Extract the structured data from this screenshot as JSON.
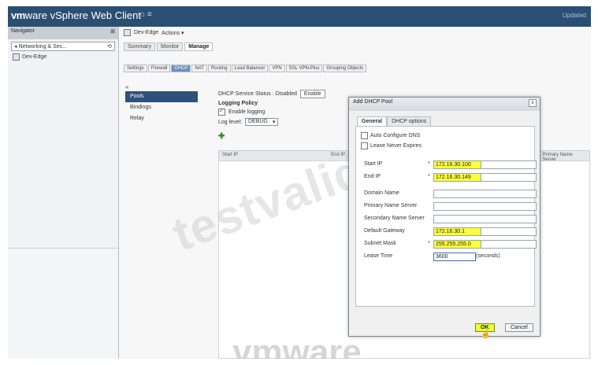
{
  "window": {
    "brand_vm": "vm",
    "brand_ware": "ware",
    "app_title": " vSphere Web Client",
    "home_label": "⌂ ≡",
    "user_text": "Updated"
  },
  "navigator": {
    "title": "Navigator",
    "pin": "⊞",
    "selector": "◂ Networking & Sec...",
    "history_icon": "⟲",
    "tree_item": "Dev-Edge"
  },
  "object": {
    "title": "Dev-Edge",
    "actions": "Actions ▾"
  },
  "tabs_primary": [
    {
      "label": "Summary",
      "active": false
    },
    {
      "label": "Monitor",
      "active": false
    },
    {
      "label": "Manage",
      "active": true
    }
  ],
  "tabs_secondary": [
    {
      "label": "Settings",
      "active": false
    },
    {
      "label": "Firewall",
      "active": false
    },
    {
      "label": "DHCP",
      "active": true
    },
    {
      "label": "NAT",
      "active": false
    },
    {
      "label": "Routing",
      "active": false
    },
    {
      "label": "Load Balancer",
      "active": false
    },
    {
      "label": "VPN",
      "active": false
    },
    {
      "label": "SSL VPN-Plus",
      "active": false
    },
    {
      "label": "Grouping Objects",
      "active": false
    }
  ],
  "dhcp_nav": {
    "back": "«",
    "items": [
      {
        "label": "Pools",
        "active": true
      },
      {
        "label": "Bindings",
        "active": false
      },
      {
        "label": "Relay",
        "active": false
      }
    ]
  },
  "dhcp_content": {
    "status_text": "DHCP Service Status : Disabled",
    "enable_button": "Enable",
    "logging_policy": "Logging Policy",
    "enable_logging": "Enable logging",
    "log_level_label": "Log level:",
    "log_level_value": "DEBUG",
    "add_icon": "✚",
    "grid_columns": [
      "Start IP",
      "End IP",
      "Primary Name Server"
    ]
  },
  "dialog": {
    "title": "Add DHCP Pool",
    "close": "x",
    "tabs": [
      {
        "label": "General",
        "active": true
      },
      {
        "label": "DHCP options",
        "active": false
      }
    ],
    "checkboxes": [
      {
        "label": "Auto Configure DNS",
        "checked": false
      },
      {
        "label": "Lease Never Expires",
        "checked": false
      }
    ],
    "fields": [
      {
        "label": "Start IP",
        "required": "*",
        "value": "172.16.30.100",
        "highlight": true
      },
      {
        "label": "End IP",
        "required": "*",
        "value": "172.16.30.149",
        "highlight": true
      },
      {
        "label": "Domain Name",
        "required": "",
        "value": "",
        "highlight": false
      },
      {
        "label": "Primary Name Server",
        "required": "",
        "value": "",
        "highlight": false
      },
      {
        "label": "Secondary Name Server",
        "required": "",
        "value": "",
        "highlight": false
      },
      {
        "label": "Default Gateway",
        "required": "",
        "value": "172.16.30.1",
        "highlight": true
      },
      {
        "label": "Subnet Mask",
        "required": "*",
        "value": "255.255.255.0",
        "highlight": true
      },
      {
        "label": "Lease Time",
        "required": "",
        "value": "3600",
        "highlight": false
      }
    ],
    "lease_unit": "(seconds)",
    "ok": "OK",
    "cancel": "Cancel"
  },
  "watermarks": {
    "testvalid": "testvalid.com",
    "vmware": "vmware"
  },
  "colors": {
    "topbar": "#2a4f72",
    "selected_nav": "#2f5179",
    "highlight": "#fbff3a"
  }
}
